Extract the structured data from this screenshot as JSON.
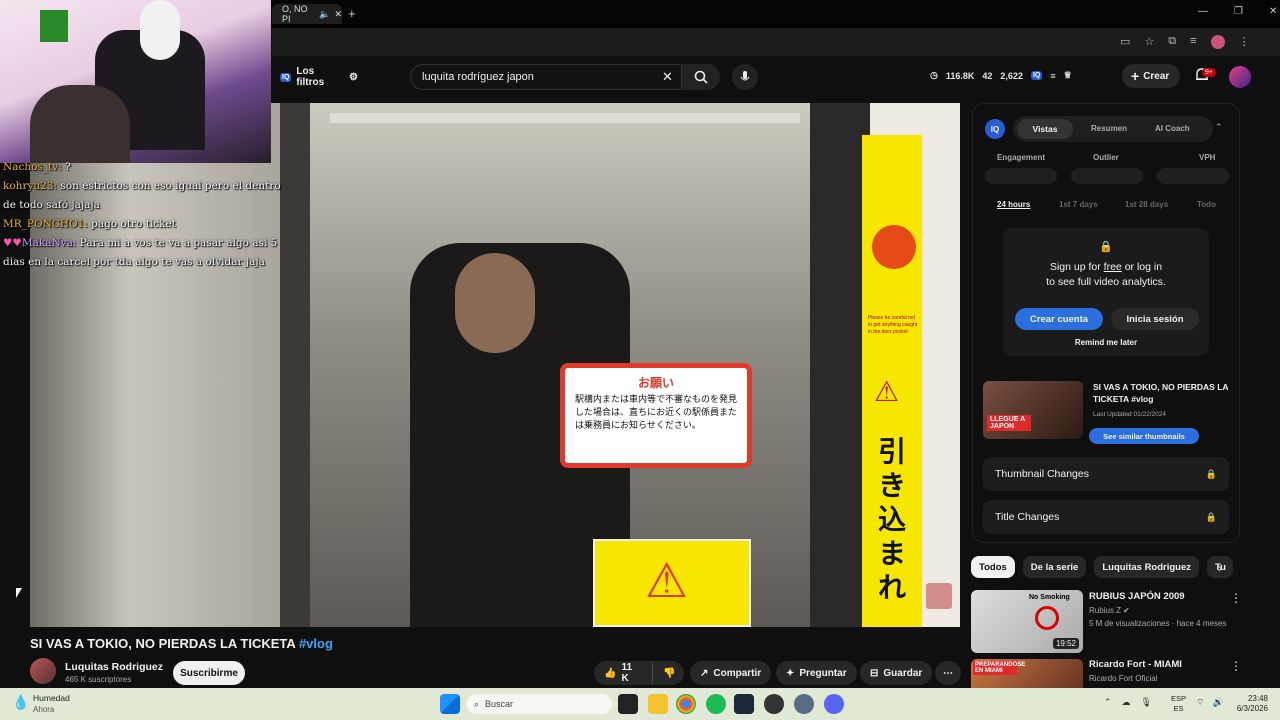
{
  "browser": {
    "tab_title": "O, NO PI",
    "extensions_hint": ""
  },
  "header": {
    "filters_label": "Los filtros",
    "search_value": "luquita rodríguez japon",
    "stats": [
      "116.8K",
      "42",
      "2,622"
    ],
    "create_label": "Crear",
    "notif_count": "9+"
  },
  "chat": [
    {
      "name": "Nachos_tv:",
      "text": "?"
    },
    {
      "name": "kohryu23:",
      "text": "son estrictos con eso igual pero el dentro de todo safó jajaja"
    },
    {
      "name": "MR_PONCHO1:",
      "text": "pago otro ticket"
    },
    {
      "name": "MakaNva:",
      "text": "Para mi a vos te va a pasar algo asi 5 dias en la carcel por tda algo te vas a olvidar jaja"
    }
  ],
  "video_sign": {
    "heading": "お願い",
    "body": "駅構内または車内等で不審なものを発見した場合は、直ちにお近くの駅係員または乗務員にお知らせください。",
    "yellow_text": "引き込まれ",
    "yellow_small": "Please be careful not to get anything caught in the door pocket"
  },
  "sidepanel": {
    "tabs": [
      "Vistas",
      "Resumen",
      "AI Coach"
    ],
    "metrics": [
      "Engagement",
      "Outlier",
      "VPH"
    ],
    "ranges": [
      "24 hours",
      "1st 7 days",
      "1st 28 days",
      "Todo"
    ],
    "signup_line1": "Sign up for",
    "signup_free": "free",
    "signup_line1b": "or log in",
    "signup_line2": "to see full video analytics.",
    "crear_cuenta": "Crear cuenta",
    "inicia_sesion": "Inicia sesión",
    "remind": "Remind me later",
    "thumb_title": "SI VAS A TOKIO, NO PIERDAS LA TICKETA #vlog",
    "thumb_overlay": "LLEGUE A JAPON",
    "last_updated": "Last Updated 01/22/2024",
    "similar_btn": "See similar thumbnails",
    "thumb_changes": "Thumbnail Changes",
    "title_changes": "Title Changes"
  },
  "chips": [
    "Todos",
    "De la serie",
    "Luquitas Rodriguez",
    "Tu"
  ],
  "recs": [
    {
      "title": "RUBIUS JAPÓN 2009",
      "channel": "Rubius Z",
      "meta": "5 M de visualizaciones · hace 4 meses",
      "duration": "19:52",
      "thumb_text": "No Smoking"
    },
    {
      "title": "Ricardo Fort - MIAMI",
      "channel": "Ricardo Fort Oficial",
      "meta": "",
      "duration": "",
      "thumb_text": "PREPARANDOSE EN MIAMI"
    }
  ],
  "video": {
    "title_main": "SI VAS A TOKIO, NO PIERDAS LA TICKETA",
    "title_tag": "#vlog",
    "channel": "Luquitas Rodriguez",
    "subs": "465 K suscriptores",
    "subscribe": "Suscribirme",
    "likes": "11 K",
    "share": "Compartir",
    "ask": "Preguntar",
    "save": "Guardar"
  },
  "taskbar": {
    "weather_title": "Humedad",
    "weather_sub": "Ahora",
    "search": "Buscar",
    "lang1": "ESP",
    "lang2": "ES",
    "time": "23:48",
    "date": "6/3/2026"
  }
}
